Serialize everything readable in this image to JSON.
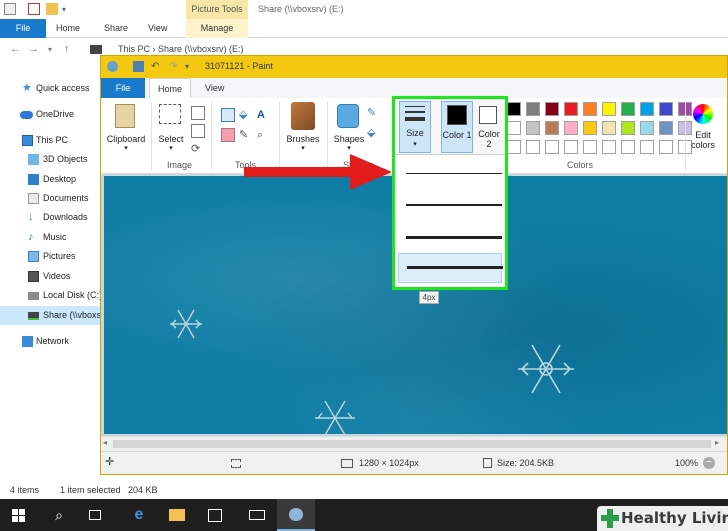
{
  "explorer": {
    "contextual_tab": "Picture Tools",
    "title": "Share (\\\\vboxsrv) (E:)",
    "tabs": {
      "file": "File",
      "home": "Home",
      "share": "Share",
      "view": "View",
      "manage": "Manage"
    },
    "address": "This PC › Share (\\\\vboxsrv) (E:)",
    "nav": [
      {
        "label": "Quick access"
      },
      {
        "label": "OneDrive"
      },
      {
        "label": "This PC"
      },
      {
        "label": "3D Objects"
      },
      {
        "label": "Desktop"
      },
      {
        "label": "Documents"
      },
      {
        "label": "Downloads"
      },
      {
        "label": "Music"
      },
      {
        "label": "Pictures"
      },
      {
        "label": "Videos"
      },
      {
        "label": "Local Disk (C:)"
      },
      {
        "label": "Share (\\\\vboxsrv) (E:)"
      },
      {
        "label": "Network"
      }
    ],
    "status": {
      "items": "4 items",
      "selected": "1 item selected",
      "size": "204 KB"
    }
  },
  "paint": {
    "title": "31071121 - Paint",
    "tabs": {
      "file": "File",
      "home": "Home",
      "view": "View"
    },
    "ribbon": {
      "clipboard": "Clipboard",
      "select": "Select",
      "image_group": "Image",
      "tools_group": "Tools",
      "brushes": "Brushes",
      "shapes": "Shapes",
      "shapes_group": "Shapes",
      "size": "Size",
      "color1": "Color 1",
      "color2": "Color 2",
      "colors_group": "Colors",
      "edit_colors": "Edit colors"
    },
    "size_tooltip": "4px",
    "status": {
      "dimensions": "1280 × 1024px",
      "file_size": "Size: 204.5KB",
      "zoom": "100%"
    },
    "palette_row1": [
      "#000000",
      "#7f7f7f",
      "#880015",
      "#ed1c24",
      "#ff7f27",
      "#fff200",
      "#22b14c",
      "#00a2e8",
      "#3f48cc",
      "#a349a4"
    ],
    "palette_row2": [
      "#ffffff",
      "#c3c3c3",
      "#b97a57",
      "#ffaec9",
      "#ffc90e",
      "#efe4b0",
      "#b5e61d",
      "#99d9ea",
      "#7092be",
      "#c8bfe7"
    ],
    "palette_row3": [
      "#ffffff",
      "#ffffff",
      "#ffffff",
      "#ffffff",
      "#ffffff",
      "#ffffff",
      "#ffffff",
      "#ffffff",
      "#ffffff",
      "#ffffff"
    ],
    "color1_value": "#000000",
    "color2_value": "#ffffff"
  },
  "colors": {
    "highlight": "#1fe51f",
    "arrow": "#e21b1b",
    "accent": "#1979ca"
  },
  "logo": {
    "text": "Healthy Living"
  }
}
